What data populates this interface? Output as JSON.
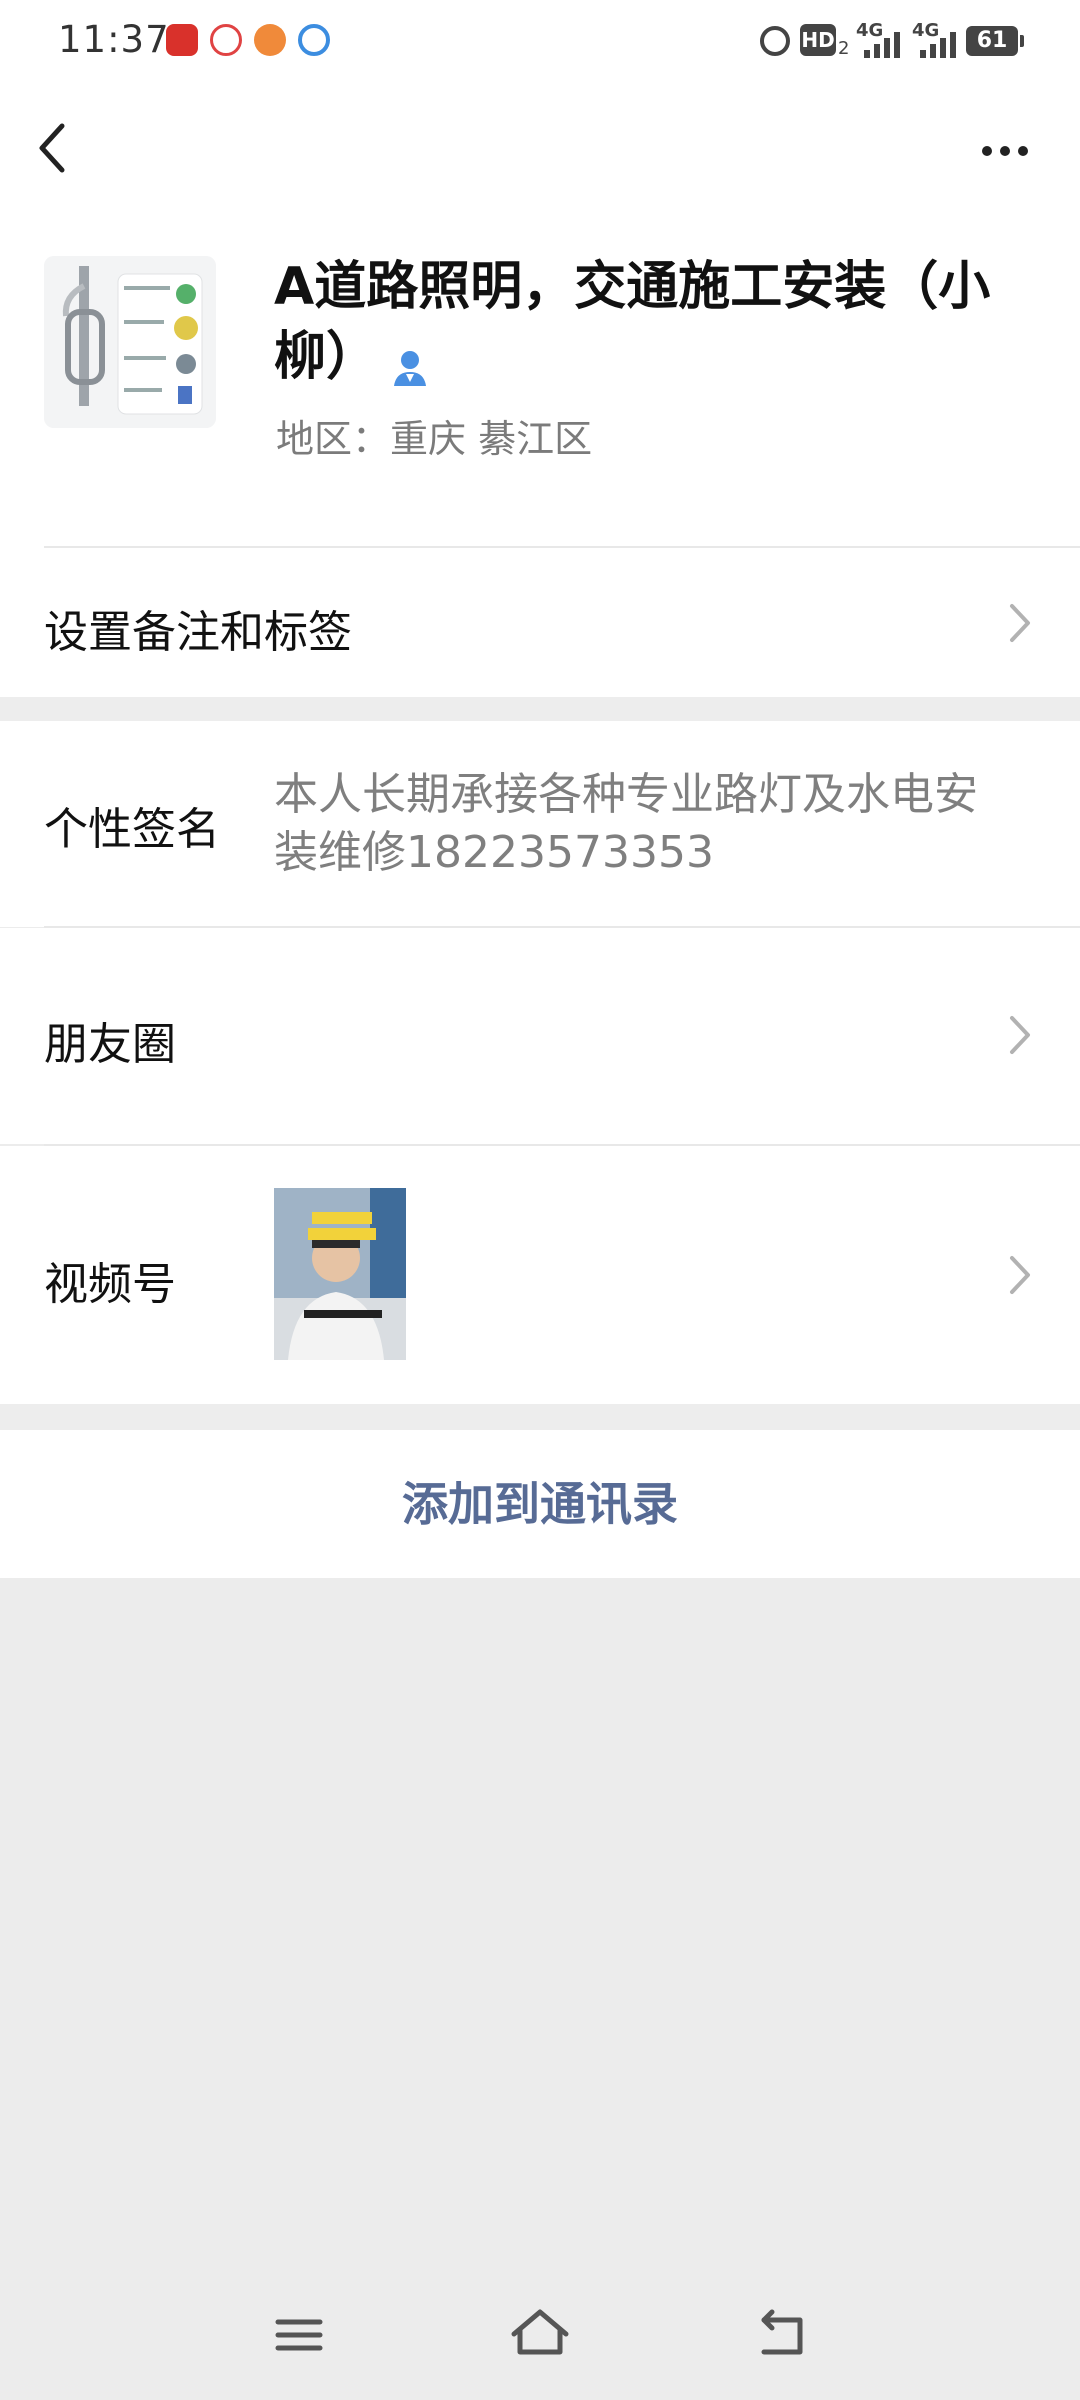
{
  "status_bar": {
    "time": "11:37",
    "hd_label": "HD",
    "hd_sub": "2",
    "net1": "4G",
    "net2": "4G",
    "battery": "61"
  },
  "nav": {
    "back_icon": "chevron-left-icon",
    "more_icon": "more-dots-icon"
  },
  "profile": {
    "name": "A道路照明，交通施工安装（小柳）",
    "region": "地区：重庆  綦江区",
    "verified_icon": "person-badge-icon"
  },
  "rows": {
    "remark": "设置备注和标签",
    "signature_label": "个性签名",
    "signature_value": "本人长期承接各种专业路灯及水电安装维修18223573353",
    "moments": "朋友圈",
    "channels": "视频号"
  },
  "actions": {
    "add_contact": "添加到通讯录"
  },
  "colors": {
    "link": "#576b95",
    "background": "#ededed",
    "verified": "#4a90e2"
  }
}
